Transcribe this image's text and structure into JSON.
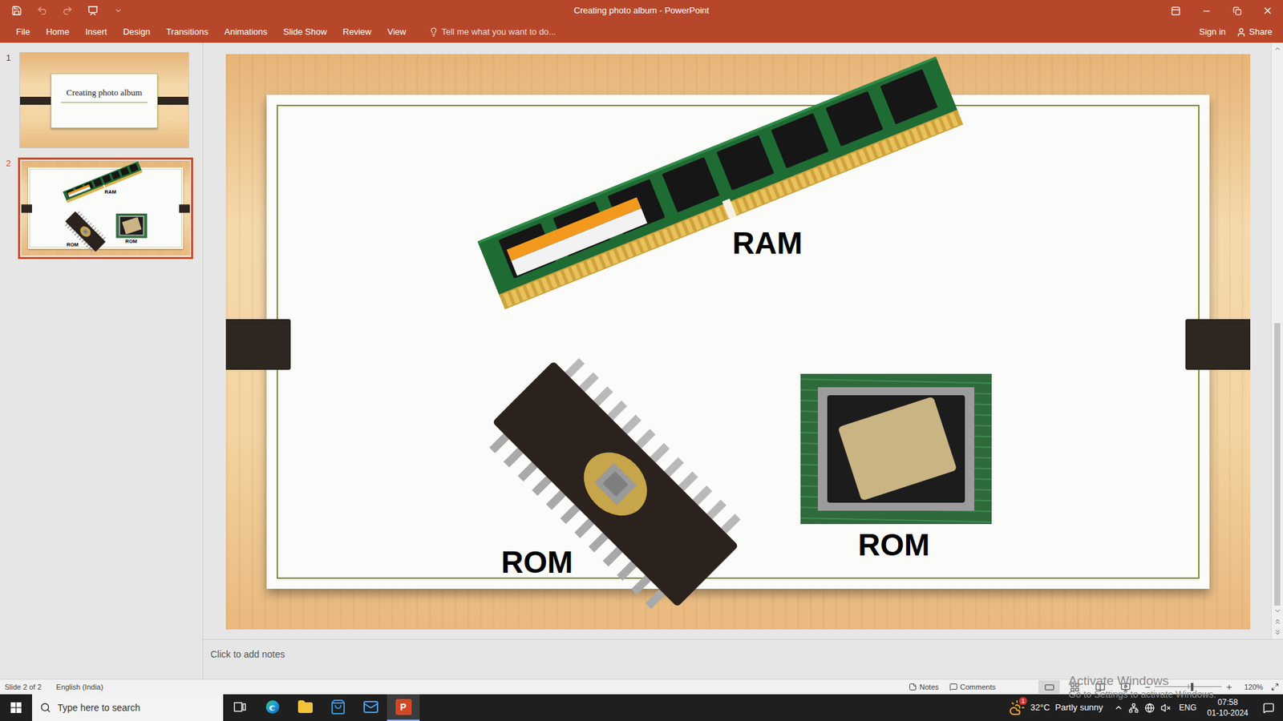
{
  "window": {
    "title": "Creating photo album - PowerPoint"
  },
  "quick_access": [
    {
      "kind": "save",
      "disabled": false
    },
    {
      "kind": "undo",
      "disabled": true
    },
    {
      "kind": "redo",
      "disabled": true
    },
    {
      "kind": "start-slideshow",
      "disabled": false
    },
    {
      "kind": "customize",
      "disabled": false
    }
  ],
  "ribbon": {
    "tabs": [
      {
        "label": "File",
        "selected": false
      },
      {
        "label": "Home",
        "selected": false
      },
      {
        "label": "Insert",
        "selected": false
      },
      {
        "label": "Design",
        "selected": false
      },
      {
        "label": "Transitions",
        "selected": false
      },
      {
        "label": "Animations",
        "selected": false
      },
      {
        "label": "Slide Show",
        "selected": false
      },
      {
        "label": "Review",
        "selected": false
      },
      {
        "label": "View",
        "selected": false
      }
    ],
    "tell_me": "Tell me what you want to do...",
    "sign_in": "Sign in",
    "share": "Share"
  },
  "slides": [
    {
      "number": "1",
      "selected": false,
      "kind": "title",
      "title": "Creating photo album",
      "pictures": []
    },
    {
      "number": "2",
      "selected": true,
      "kind": "pictures",
      "title": "",
      "pictures": [
        {
          "kind": "ram-module",
          "caption": "RAM"
        },
        {
          "kind": "eprom-chip",
          "caption": "ROM"
        },
        {
          "kind": "bios-chip",
          "caption": "ROM"
        }
      ]
    }
  ],
  "notes": {
    "placeholder": "Click to add notes"
  },
  "watermark": {
    "title": "Activate Windows",
    "subtitle": "Go to Settings to activate Windows."
  },
  "status_bar": {
    "slide": "Slide 2 of 2",
    "language": "English (India)",
    "notes": "Notes",
    "comments": "Comments",
    "views": [
      {
        "kind": "normal",
        "selected": true
      },
      {
        "kind": "sorter",
        "selected": false
      },
      {
        "kind": "reading",
        "selected": false
      },
      {
        "kind": "slideshow",
        "selected": false
      }
    ],
    "zoom": "120%",
    "zoom_level": 0.56
  },
  "taskbar": {
    "search": {
      "placeholder": "Type here to search"
    },
    "apps": [
      {
        "kind": "task-view",
        "selected": false,
        "glyph": ""
      },
      {
        "kind": "edge",
        "selected": false,
        "glyph": ""
      },
      {
        "kind": "file-explorer",
        "selected": false,
        "glyph": ""
      },
      {
        "kind": "store",
        "selected": false,
        "glyph": ""
      },
      {
        "kind": "mail",
        "selected": false,
        "glyph": ""
      },
      {
        "kind": "powerpoint",
        "selected": true,
        "glyph": "P"
      }
    ],
    "weather": {
      "temperature": "32°C",
      "condition": "Partly sunny",
      "badge": "1"
    },
    "language": "ENG",
    "time": "07:58",
    "date": "01-10-2024"
  }
}
